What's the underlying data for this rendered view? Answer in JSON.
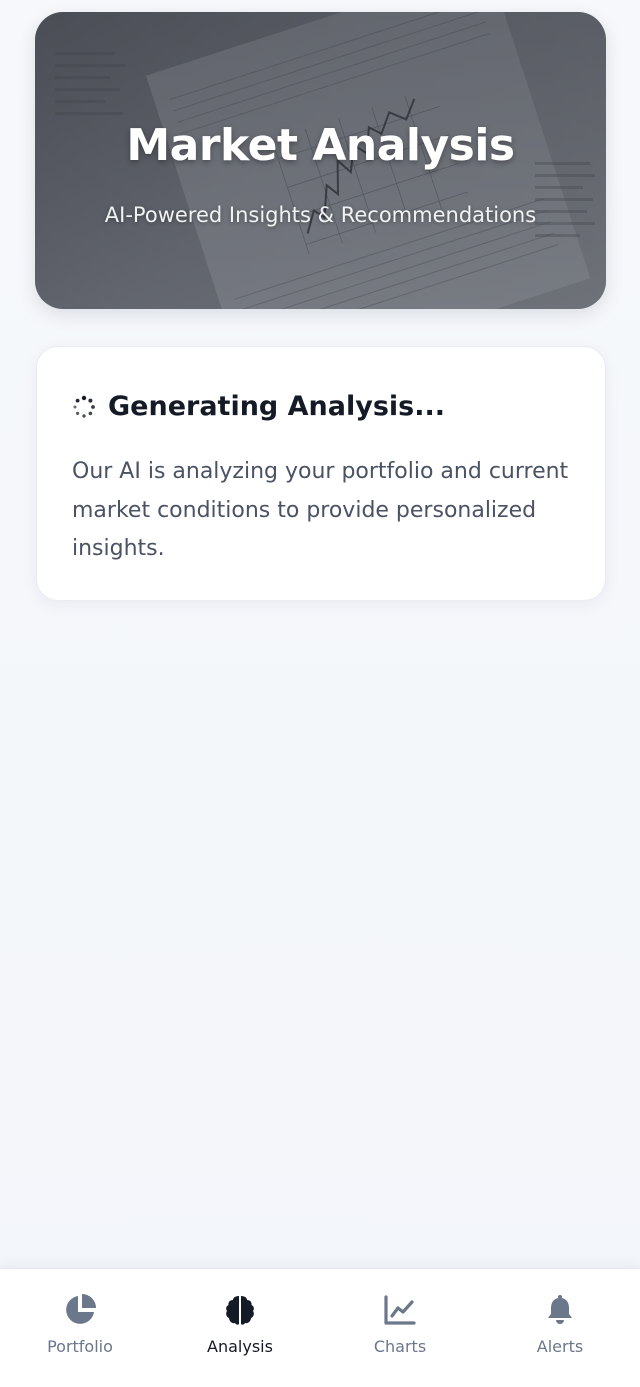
{
  "hero": {
    "title": "Market Analysis",
    "subtitle": "AI-Powered Insights & Recommendations"
  },
  "status_card": {
    "icon": "spinner-icon",
    "title": "Generating Analysis...",
    "message": "Our AI is analyzing your portfolio and current market conditions to provide personalized insights."
  },
  "bottom_nav": {
    "items": [
      {
        "label": "Portfolio",
        "icon": "pie-chart-icon",
        "active": false
      },
      {
        "label": "Analysis",
        "icon": "brain-icon",
        "active": true
      },
      {
        "label": "Charts",
        "icon": "line-chart-icon",
        "active": false
      },
      {
        "label": "Alerts",
        "icon": "bell-icon",
        "active": false
      }
    ]
  },
  "colors": {
    "background": "#f3f6fa",
    "card": "#ffffff",
    "title_text": "#141a26",
    "body_text": "#4a5264",
    "nav_inactive": "#6b778a",
    "nav_active": "#141a26"
  }
}
